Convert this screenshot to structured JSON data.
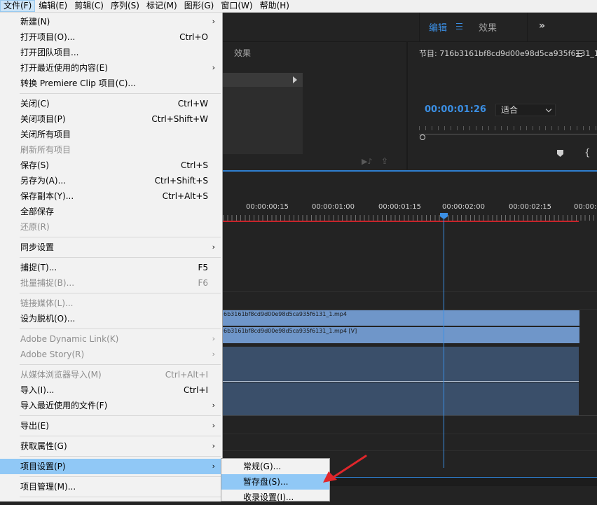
{
  "menubar": {
    "items": [
      "文件(F)",
      "编辑(E)",
      "剪辑(C)",
      "序列(S)",
      "标记(M)",
      "图形(G)",
      "窗口(W)",
      "帮助(H)"
    ]
  },
  "workspace": {
    "active_tab": "编辑",
    "other_tab": "效果"
  },
  "source_panel": {
    "tab_label": "效果"
  },
  "program_monitor": {
    "title": "节目: 716b3161bf8cd9d00e98d5ca935f6131_1",
    "timecode": "00:00:01:26",
    "fit_label": "适合"
  },
  "timeline": {
    "timecodes": [
      "00:00:00:15",
      "00:00:01:00",
      "00:00:01:15",
      "00:00:02:00",
      "00:00:02:15",
      "00:00:0"
    ],
    "clip_v2_label": "6b3161bf8cd9d00e98d5ca935f6131_1.mp4",
    "clip_v1_label": "6b3161bf8cd9d00e98d5ca935f6131_1.mp4 [V]"
  },
  "file_menu": {
    "items": [
      {
        "label": "新建(N)",
        "shortcut": "",
        "arrow": true,
        "disabled": false
      },
      {
        "label": "打开项目(O)...",
        "shortcut": "Ctrl+O",
        "arrow": false,
        "disabled": false
      },
      {
        "label": "打开团队项目...",
        "shortcut": "",
        "arrow": false,
        "disabled": false
      },
      {
        "label": "打开最近使用的内容(E)",
        "shortcut": "",
        "arrow": true,
        "disabled": false
      },
      {
        "label": "转换 Premiere Clip 项目(C)...",
        "shortcut": "",
        "arrow": false,
        "disabled": false
      },
      {
        "label": "关闭(C)",
        "shortcut": "Ctrl+W",
        "arrow": false,
        "disabled": false
      },
      {
        "label": "关闭项目(P)",
        "shortcut": "Ctrl+Shift+W",
        "arrow": false,
        "disabled": false
      },
      {
        "label": "关闭所有项目",
        "shortcut": "",
        "arrow": false,
        "disabled": false
      },
      {
        "label": "刷新所有项目",
        "shortcut": "",
        "arrow": false,
        "disabled": true
      },
      {
        "label": "保存(S)",
        "shortcut": "Ctrl+S",
        "arrow": false,
        "disabled": false
      },
      {
        "label": "另存为(A)...",
        "shortcut": "Ctrl+Shift+S",
        "arrow": false,
        "disabled": false
      },
      {
        "label": "保存副本(Y)...",
        "shortcut": "Ctrl+Alt+S",
        "arrow": false,
        "disabled": false
      },
      {
        "label": "全部保存",
        "shortcut": "",
        "arrow": false,
        "disabled": false
      },
      {
        "label": "还原(R)",
        "shortcut": "",
        "arrow": false,
        "disabled": true
      },
      {
        "label": "同步设置",
        "shortcut": "",
        "arrow": true,
        "disabled": false
      },
      {
        "label": "捕捉(T)...",
        "shortcut": "F5",
        "arrow": false,
        "disabled": false
      },
      {
        "label": "批量捕捉(B)...",
        "shortcut": "F6",
        "arrow": false,
        "disabled": true
      },
      {
        "label": "链接媒体(L)...",
        "shortcut": "",
        "arrow": false,
        "disabled": true
      },
      {
        "label": "设为脱机(O)...",
        "shortcut": "",
        "arrow": false,
        "disabled": false
      },
      {
        "label": "Adobe Dynamic Link(K)",
        "shortcut": "",
        "arrow": true,
        "disabled": true
      },
      {
        "label": "Adobe Story(R)",
        "shortcut": "",
        "arrow": true,
        "disabled": true
      },
      {
        "label": "从媒体浏览器导入(M)",
        "shortcut": "Ctrl+Alt+I",
        "arrow": false,
        "disabled": true
      },
      {
        "label": "导入(I)...",
        "shortcut": "Ctrl+I",
        "arrow": false,
        "disabled": false
      },
      {
        "label": "导入最近使用的文件(F)",
        "shortcut": "",
        "arrow": true,
        "disabled": false
      },
      {
        "label": "导出(E)",
        "shortcut": "",
        "arrow": true,
        "disabled": false
      },
      {
        "label": "获取属性(G)",
        "shortcut": "",
        "arrow": true,
        "disabled": false
      },
      {
        "label": "项目设置(P)",
        "shortcut": "",
        "arrow": true,
        "disabled": false,
        "highlighted": true
      },
      {
        "label": "项目管理(M)...",
        "shortcut": "",
        "arrow": false,
        "disabled": false
      }
    ]
  },
  "project_settings_submenu": {
    "items": [
      {
        "label": "常规(G)...",
        "highlighted": false
      },
      {
        "label": "暂存盘(S)...",
        "highlighted": true
      },
      {
        "label": "收录设置(I)...",
        "highlighted": false
      }
    ]
  },
  "colors": {
    "accent": "#3b8fe4",
    "highlight": "#90c8f6",
    "clip": "#6f96c9",
    "playhead": "#3b8fe4",
    "annotation_arrow": "#e0262b"
  }
}
